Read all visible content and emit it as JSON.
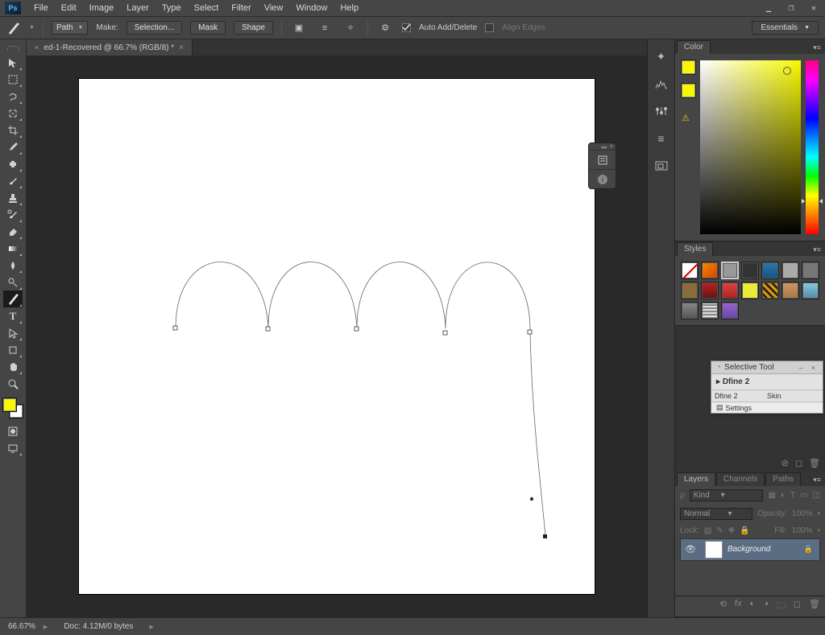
{
  "app_logo": "Ps",
  "menu": [
    "File",
    "Edit",
    "Image",
    "Layer",
    "Type",
    "Select",
    "Filter",
    "View",
    "Window",
    "Help"
  ],
  "workspace_switcher": "Essentials",
  "options": {
    "mode_label": "Path",
    "make_label": "Make:",
    "make_selection": "Selection...",
    "make_mask": "Mask",
    "make_shape": "Shape",
    "auto_add_delete": "Auto Add/Delete",
    "align_edges": "Align Edges"
  },
  "document": {
    "tab_title": "ed-1-Recovered @ 66.7% (RGB/8) *",
    "zoom": "66.67%",
    "doc_info": "Doc: 4.12M/0 bytes"
  },
  "panels": {
    "color": "Color",
    "styles": "Styles",
    "layers": "Layers",
    "channels": "Channels",
    "paths": "Paths"
  },
  "selective_tool": {
    "title": "Selective Tool",
    "name": "Dfine 2",
    "col1": "Dfine 2",
    "col2": "Skin",
    "settings": "Settings"
  },
  "layers": {
    "kind_label": "Kind",
    "blend_mode": "Normal",
    "opacity_label": "Opacity:",
    "opacity_value": "100%",
    "lock_label": "Lock:",
    "fill_label": "Fill:",
    "fill_value": "100%",
    "layer_name": "Background"
  }
}
